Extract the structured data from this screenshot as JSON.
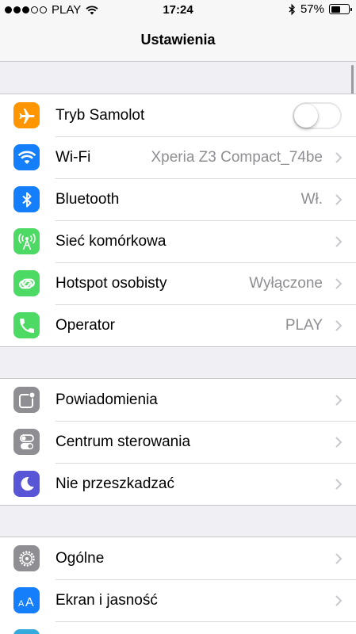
{
  "status_bar": {
    "carrier": "PLAY",
    "time": "17:24",
    "battery_percent": "57%",
    "battery_level": 0.57,
    "signal_dots_filled": 3,
    "signal_dots_total": 5
  },
  "navbar": {
    "title": "Ustawienia"
  },
  "groups": [
    {
      "rows": [
        {
          "label": "Tryb Samolot",
          "icon": "airplane-icon",
          "color": "#ff9500",
          "toggle": true,
          "toggle_on": false
        },
        {
          "label": "Wi-Fi",
          "value": "Xperia Z3 Compact_74be",
          "icon": "wifi-icon",
          "color": "#147efb"
        },
        {
          "label": "Bluetooth",
          "value": "Wł.",
          "icon": "bluetooth-icon",
          "color": "#147efb"
        },
        {
          "label": "Sieć komórkowa",
          "icon": "cellular-icon",
          "color": "#4cd964"
        },
        {
          "label": "Hotspot osobisty",
          "value": "Wyłączone",
          "icon": "hotspot-icon",
          "color": "#4cd964"
        },
        {
          "label": "Operator",
          "value": "PLAY",
          "icon": "phone-icon",
          "color": "#4cd964"
        }
      ]
    },
    {
      "rows": [
        {
          "label": "Powiadomienia",
          "icon": "notifications-icon",
          "color": "#8e8e93"
        },
        {
          "label": "Centrum sterowania",
          "icon": "control-center-icon",
          "color": "#8e8e93"
        },
        {
          "label": "Nie przeszkadzać",
          "icon": "moon-icon",
          "color": "#5856d6"
        }
      ]
    },
    {
      "rows": [
        {
          "label": "Ogólne",
          "icon": "gear-icon",
          "color": "#8e8e93"
        },
        {
          "label": "Ekran i jasność",
          "icon": "display-brightness-icon",
          "color": "#147efb"
        },
        {
          "label": "",
          "icon": "wallpaper-icon",
          "color": "#34aadc"
        }
      ]
    }
  ]
}
